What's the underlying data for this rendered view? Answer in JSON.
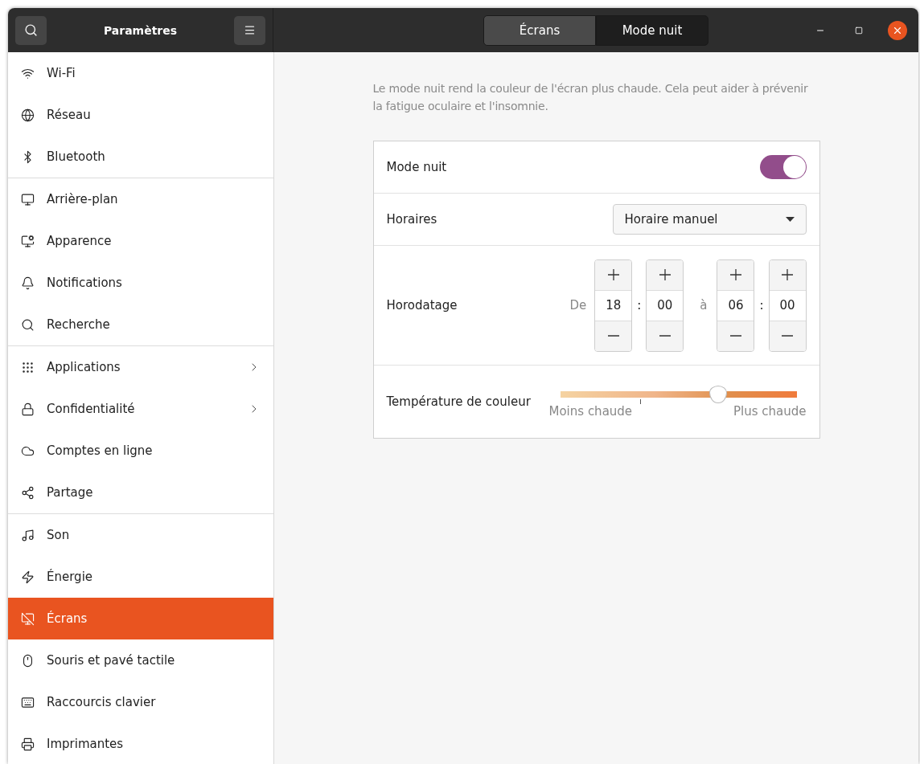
{
  "header": {
    "title": "Paramètres",
    "tabs": [
      {
        "label": "Écrans",
        "selected": false
      },
      {
        "label": "Mode nuit",
        "selected": true
      }
    ]
  },
  "sidebar": {
    "groups": [
      {
        "items": [
          {
            "label": "Wi-Fi",
            "selected": false,
            "has_submenu": false
          },
          {
            "label": "Réseau",
            "selected": false,
            "has_submenu": false
          },
          {
            "label": "Bluetooth",
            "selected": false,
            "has_submenu": false
          }
        ]
      },
      {
        "items": [
          {
            "label": "Arrière-plan",
            "selected": false,
            "has_submenu": false
          },
          {
            "label": "Apparence",
            "selected": false,
            "has_submenu": false
          },
          {
            "label": "Notifications",
            "selected": false,
            "has_submenu": false
          },
          {
            "label": "Recherche",
            "selected": false,
            "has_submenu": false
          }
        ]
      },
      {
        "items": [
          {
            "label": "Applications",
            "selected": false,
            "has_submenu": true
          },
          {
            "label": "Confidentialité",
            "selected": false,
            "has_submenu": true
          },
          {
            "label": "Comptes en ligne",
            "selected": false,
            "has_submenu": false
          },
          {
            "label": "Partage",
            "selected": false,
            "has_submenu": false
          }
        ]
      },
      {
        "items": [
          {
            "label": "Son",
            "selected": false,
            "has_submenu": false
          },
          {
            "label": "Énergie",
            "selected": false,
            "has_submenu": false
          },
          {
            "label": "Écrans",
            "selected": true,
            "has_submenu": false
          },
          {
            "label": "Souris et pavé tactile",
            "selected": false,
            "has_submenu": false
          },
          {
            "label": "Raccourcis clavier",
            "selected": false,
            "has_submenu": false
          },
          {
            "label": "Imprimantes",
            "selected": false,
            "has_submenu": false
          }
        ]
      }
    ]
  },
  "description": "Le mode nuit rend la couleur de l'écran plus chaude. Cela peut aider à prévenir la fatigue oculaire et l'insomnie.",
  "night_mode": {
    "label": "Mode nuit",
    "on": true
  },
  "schedule": {
    "label": "Horaires",
    "value": "Horaire manuel"
  },
  "times": {
    "label": "Horodatage",
    "from_label": "De",
    "to_label": "à",
    "from": {
      "hours": "18",
      "separator": ":",
      "minutes": "00"
    },
    "to": {
      "hours": "06",
      "separator": ":",
      "minutes": "00"
    }
  },
  "temperature": {
    "label": "Température de couleur",
    "level": 0.67,
    "min_label": "Moins chaude",
    "max_label": "Plus chaude"
  }
}
